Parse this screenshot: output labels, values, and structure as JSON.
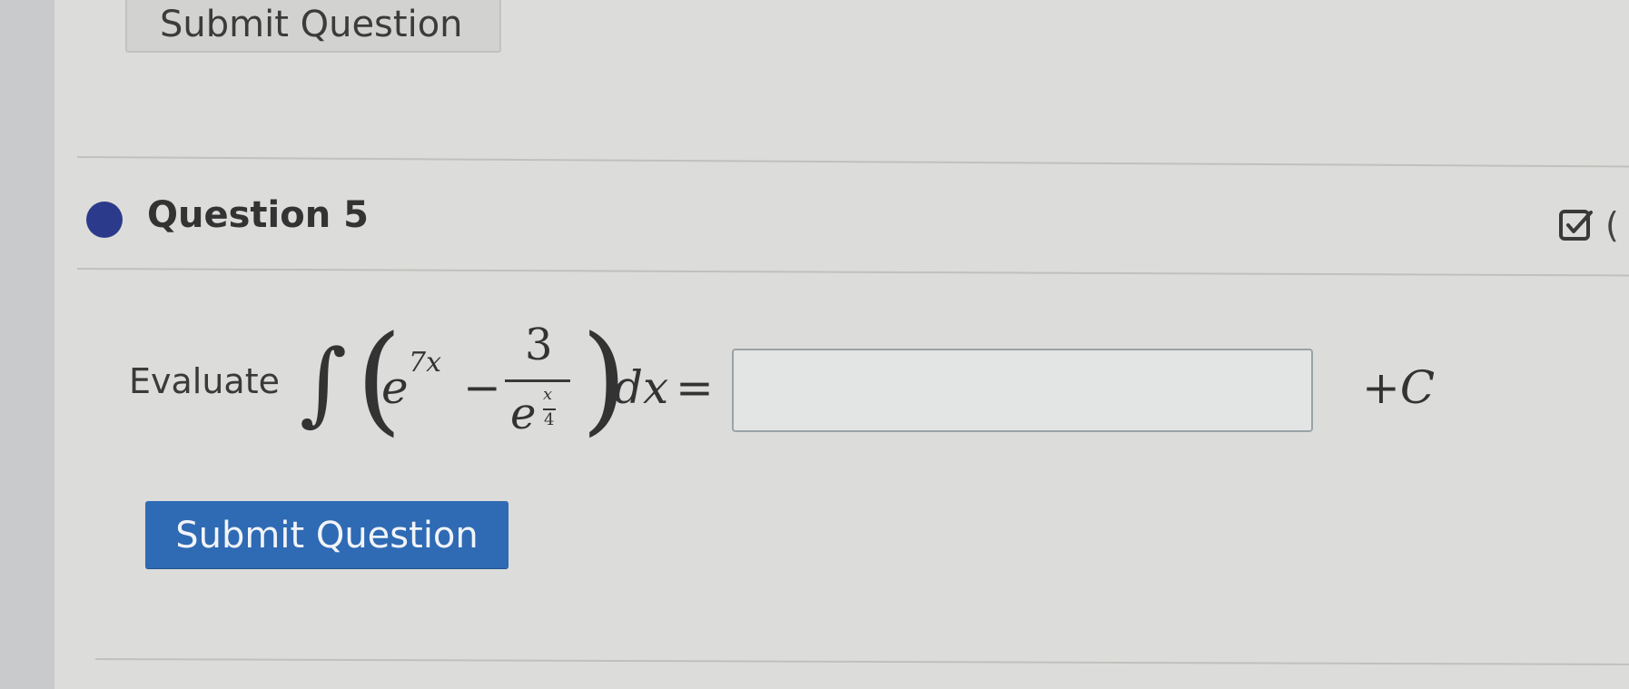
{
  "page": {
    "top_submit_label": "Submit Question"
  },
  "question": {
    "title": "Question 5",
    "status_color": "#2c3a8c",
    "edit_icon": "edit-checkbox-icon",
    "prompt_label": "Evaluate",
    "math": {
      "integral": "∫",
      "left_paren": "(",
      "e_base": "e",
      "exponent_7x": "7x",
      "minus": "−",
      "numerator": "3",
      "denominator_base": "e",
      "denominator_exp_num": "x",
      "denominator_exp_den": "4",
      "right_paren": ")",
      "dx": "dx",
      "equals": "=",
      "constant": "+C"
    },
    "answer": {
      "value": "",
      "placeholder": ""
    },
    "submit_label": "Submit Question",
    "submit_color": "#2f6ab4"
  }
}
